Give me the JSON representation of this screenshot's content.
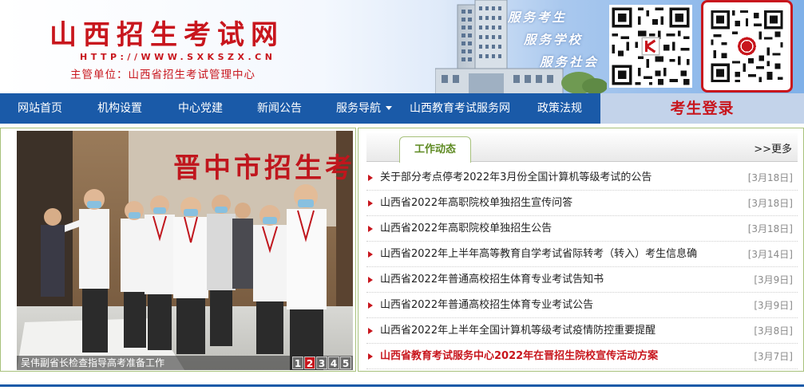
{
  "header": {
    "title": "山西招生考试网",
    "url": "HTTP://WWW.SXKSZX.CN",
    "sponsor": "主管单位：山西省招生考试管理中心",
    "slogans": [
      "服务考生",
      "服务学校",
      "服务社会"
    ]
  },
  "nav": {
    "items": [
      {
        "label": "网站首页"
      },
      {
        "label": "机构设置"
      },
      {
        "label": "中心党建"
      },
      {
        "label": "新闻公告"
      },
      {
        "label": "服务导航"
      },
      {
        "label": "山西教育考试服务网"
      },
      {
        "label": "政策法规"
      }
    ],
    "login": "考生登录"
  },
  "slideshow": {
    "photo_text": "晋中市招生考",
    "caption": "吴伟副省长检查指导高考准备工作",
    "pages": [
      "1",
      "2",
      "3",
      "4",
      "5"
    ],
    "active_page": "2"
  },
  "news": {
    "tab": "工作动态",
    "more": ">>更多",
    "items": [
      {
        "title": "关于部分考点停考2022年3月份全国计算机等级考试的公告",
        "date": "[3月18日]"
      },
      {
        "title": "山西省2022年高职院校单独招生宣传问答",
        "date": "[3月18日]"
      },
      {
        "title": "山西省2022年高职院校单独招生公告",
        "date": "[3月18日]"
      },
      {
        "title": "山西省2022年上半年高等教育自学考试省际转考（转入）考生信息确",
        "date": "[3月14日]"
      },
      {
        "title": "山西省2022年普通高校招生体育专业考试告知书",
        "date": "[3月9日]"
      },
      {
        "title": "山西省2022年普通高校招生体育专业考试公告",
        "date": "[3月9日]"
      },
      {
        "title": "山西省2022年上半年全国计算机等级考试疫情防控重要提醒",
        "date": "[3月8日]"
      },
      {
        "title": "山西省教育考试服务中心2022年在晋招生院校宣传活动方案",
        "date": "[3月7日]"
      }
    ]
  },
  "colors": {
    "brand_red": "#c8161d",
    "nav_blue": "#1a5aa8",
    "frame_green": "#a7c17b",
    "tab_green": "#5e8a22"
  }
}
